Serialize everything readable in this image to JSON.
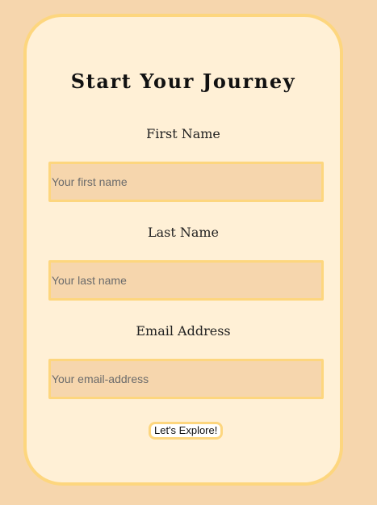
{
  "form": {
    "title": "Start Your Journey",
    "fields": [
      {
        "label": "First Name",
        "placeholder": "Your first name",
        "value": ""
      },
      {
        "label": "Last Name",
        "placeholder": "Your last name",
        "value": ""
      },
      {
        "label": "Email Address",
        "placeholder": "Your email-address",
        "value": ""
      }
    ],
    "submit_label": "Let's Explore!"
  },
  "colors": {
    "page_background": "#f6d6ad",
    "card_background": "#fff0d6",
    "accent_border": "#fdd67e",
    "input_background": "#f6d6ad"
  }
}
